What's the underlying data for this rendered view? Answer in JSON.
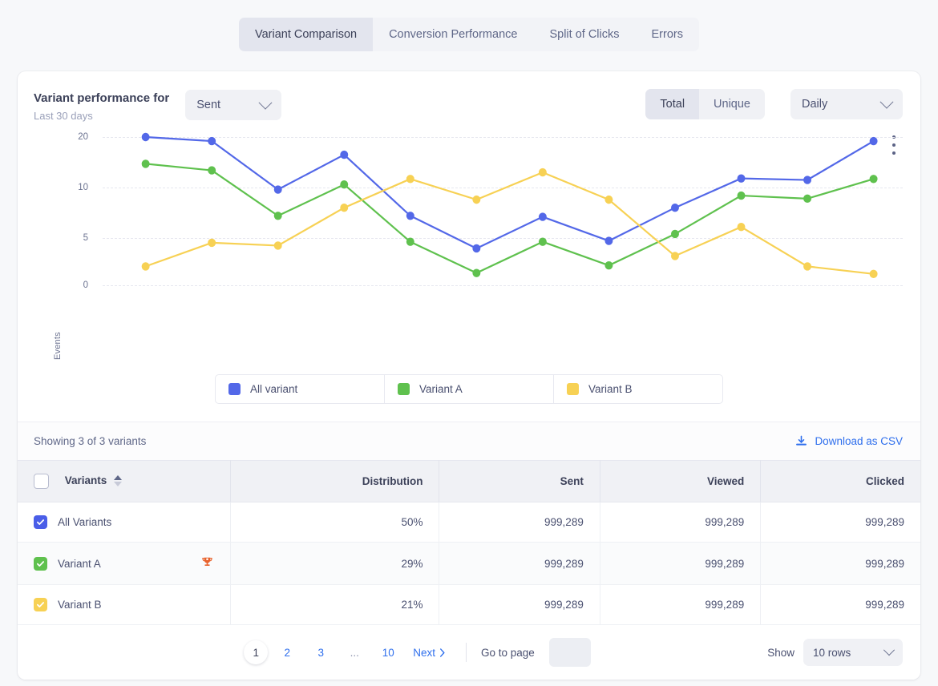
{
  "tabs": [
    {
      "label": "Variant Comparison",
      "active": true
    },
    {
      "label": "Conversion Performance",
      "active": false
    },
    {
      "label": "Split of Clicks",
      "active": false
    },
    {
      "label": "Errors",
      "active": false
    }
  ],
  "chart_header": {
    "title": "Variant performance for",
    "subtitle": "Last 30 days",
    "metric_select": "Sent",
    "segmented": [
      {
        "label": "Total",
        "active": true
      },
      {
        "label": "Unique",
        "active": false
      }
    ],
    "interval_select": "Daily",
    "menu_icon": "kebab-menu-icon"
  },
  "chart_data": {
    "type": "line",
    "title": "Variant performance for",
    "xlabel": "",
    "ylabel": "Events",
    "ylim": [
      0,
      22
    ],
    "yticks": [
      0,
      5,
      10,
      20
    ],
    "grid": true,
    "legend_position": "bottom",
    "x": [
      1,
      2,
      3,
      4,
      5,
      6,
      7,
      8,
      9,
      10,
      11,
      12,
      13
    ],
    "series": [
      {
        "name": "All variant",
        "color": "#5368e8",
        "values": [
          20.0,
          19.2,
          9.8,
          16.5,
          7.2,
          3.9,
          7.1,
          4.7,
          8.0,
          11.8,
          11.5,
          19.2
        ]
      },
      {
        "name": "Variant A",
        "color": "#5fc14e",
        "values": [
          14.7,
          13.4,
          7.2,
          10.6,
          4.6,
          1.3,
          4.6,
          2.1,
          5.4,
          9.2,
          8.9,
          11.7
        ]
      },
      {
        "name": "Variant B",
        "color": "#f7d154",
        "values": [
          2.0,
          4.5,
          4.2,
          8.0,
          11.7,
          8.8,
          13.0,
          8.8,
          3.1,
          6.1,
          2.0,
          1.2
        ]
      }
    ],
    "legend": [
      {
        "label": "All variant",
        "color": "#5368e8"
      },
      {
        "label": "Variant A",
        "color": "#5fc14e"
      },
      {
        "label": "Variant B",
        "color": "#f7d154"
      }
    ]
  },
  "table_bar": {
    "showing": "Showing 3 of 3 variants",
    "download_label": "Download as CSV",
    "download_icon": "download-icon"
  },
  "table": {
    "select_all_checked": false,
    "columns": [
      "Variants",
      "Distribution",
      "Sent",
      "Viewed",
      "Clicked"
    ],
    "rows": [
      {
        "name": "All Variants",
        "checked": true,
        "color": "#4a5ee8",
        "winner": false,
        "distribution": "50%",
        "sent": "999,289",
        "viewed": "999,289",
        "clicked": "999,289"
      },
      {
        "name": "Variant A",
        "checked": true,
        "color": "#5fc14e",
        "winner": true,
        "winner_icon": "trophy-icon",
        "distribution": "29%",
        "sent": "999,289",
        "viewed": "999,289",
        "clicked": "999,289"
      },
      {
        "name": "Variant B",
        "checked": true,
        "color": "#f7d154",
        "winner": false,
        "distribution": "21%",
        "sent": "999,289",
        "viewed": "999,289",
        "clicked": "999,289"
      }
    ]
  },
  "pagination": {
    "pages": [
      "1",
      "2",
      "3",
      "...",
      "10"
    ],
    "current": "1",
    "next_label": "Next",
    "goto_label": "Go to page",
    "goto_value": "",
    "show_label": "Show",
    "rows_value": "10 rows"
  }
}
